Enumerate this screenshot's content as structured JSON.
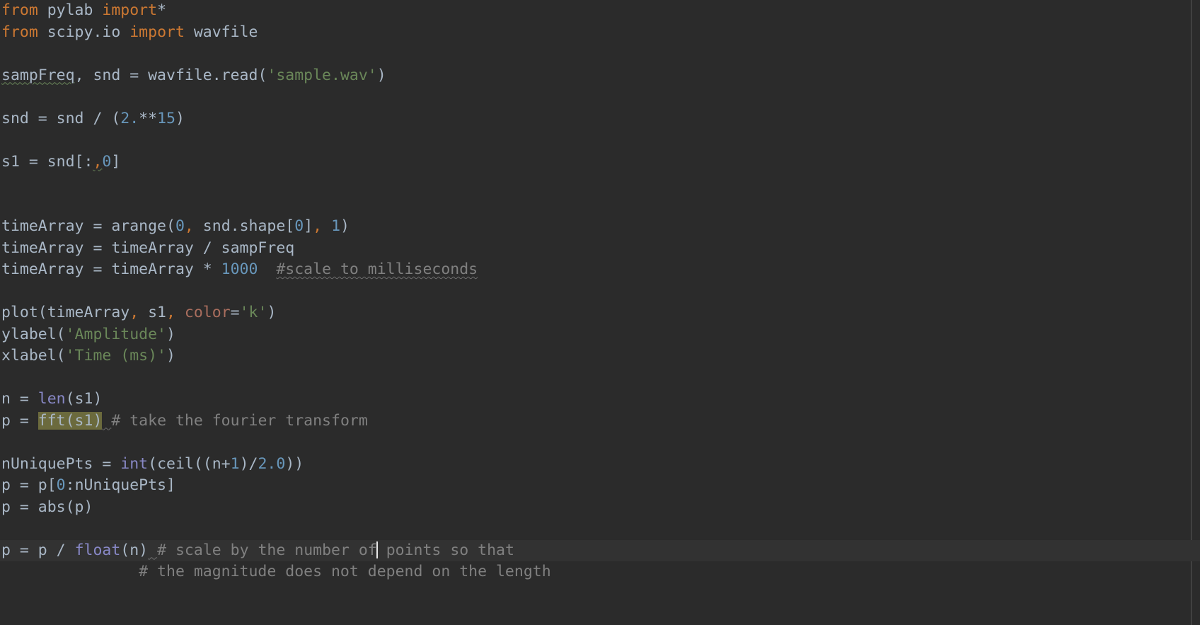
{
  "editor": {
    "language": "python",
    "theme": "darcula",
    "background_color": "#2b2b2b",
    "current_line_color": "#323232",
    "default_text_color": "#a9b7c6",
    "keyword_color": "#cc7832",
    "number_color": "#6897bb",
    "string_color": "#6a8759",
    "comment_color": "#808080",
    "builtin_color": "#8888c6",
    "keyword_arg_color": "#aa6e5e",
    "selection_color": "#6b6a3d",
    "caret_color": "#e8e8e8",
    "margin_guide_color": "#555555",
    "selected_text": "fft(s1)",
    "caret_line_index": 27
  },
  "lines": [
    {
      "index": 0,
      "tokens": [
        {
          "t": "from",
          "c": "kw"
        },
        {
          "t": " pylab ",
          "c": "plain"
        },
        {
          "t": "import",
          "c": "kw"
        },
        {
          "t": "*",
          "c": "plain"
        }
      ]
    },
    {
      "index": 1,
      "tokens": [
        {
          "t": "from",
          "c": "kw"
        },
        {
          "t": " scipy.io ",
          "c": "plain"
        },
        {
          "t": "import",
          "c": "kw"
        },
        {
          "t": " wavfile",
          "c": "plain"
        }
      ]
    },
    {
      "index": 2,
      "tokens": []
    },
    {
      "index": 3,
      "tokens": [
        {
          "t": "sampFreq",
          "c": "plain squig"
        },
        {
          "t": ", snd = wavfile.read(",
          "c": "plain"
        },
        {
          "t": "'sample.wav'",
          "c": "str"
        },
        {
          "t": ")",
          "c": "plain"
        }
      ]
    },
    {
      "index": 4,
      "tokens": []
    },
    {
      "index": 5,
      "tokens": [
        {
          "t": "snd = snd / (",
          "c": "plain"
        },
        {
          "t": "2.",
          "c": "num"
        },
        {
          "t": "**",
          "c": "plain"
        },
        {
          "t": "15",
          "c": "num"
        },
        {
          "t": ")",
          "c": "plain"
        }
      ]
    },
    {
      "index": 6,
      "tokens": []
    },
    {
      "index": 7,
      "tokens": [
        {
          "t": "s1 = snd[:",
          "c": "plain"
        },
        {
          "t": ",",
          "c": "comma squig"
        },
        {
          "t": "0",
          "c": "num"
        },
        {
          "t": "]",
          "c": "plain"
        }
      ]
    },
    {
      "index": 8,
      "tokens": []
    },
    {
      "index": 9,
      "tokens": []
    },
    {
      "index": 10,
      "tokens": [
        {
          "t": "timeArray = arange(",
          "c": "plain"
        },
        {
          "t": "0",
          "c": "num"
        },
        {
          "t": ",",
          "c": "comma"
        },
        {
          "t": " snd.shape[",
          "c": "plain"
        },
        {
          "t": "0",
          "c": "num"
        },
        {
          "t": "]",
          "c": "plain"
        },
        {
          "t": ",",
          "c": "comma"
        },
        {
          "t": " ",
          "c": "plain"
        },
        {
          "t": "1",
          "c": "num"
        },
        {
          "t": ")",
          "c": "plain"
        }
      ]
    },
    {
      "index": 11,
      "tokens": [
        {
          "t": "timeArray = timeArray / sampFreq",
          "c": "plain"
        }
      ]
    },
    {
      "index": 12,
      "tokens": [
        {
          "t": "timeArray = timeArray * ",
          "c": "plain"
        },
        {
          "t": "1000",
          "c": "num"
        },
        {
          "t": "  ",
          "c": "plain"
        },
        {
          "t": "#scale to milliseconds",
          "c": "cmt squig-gray"
        }
      ]
    },
    {
      "index": 13,
      "tokens": []
    },
    {
      "index": 14,
      "tokens": [
        {
          "t": "plot(timeArray",
          "c": "plain"
        },
        {
          "t": ",",
          "c": "comma"
        },
        {
          "t": " s1",
          "c": "plain"
        },
        {
          "t": ",",
          "c": "comma"
        },
        {
          "t": " ",
          "c": "plain"
        },
        {
          "t": "color",
          "c": "kwarg"
        },
        {
          "t": "=",
          "c": "plain"
        },
        {
          "t": "'k'",
          "c": "str"
        },
        {
          "t": ")",
          "c": "plain"
        }
      ]
    },
    {
      "index": 15,
      "tokens": [
        {
          "t": "ylabel(",
          "c": "plain"
        },
        {
          "t": "'Amplitude'",
          "c": "str"
        },
        {
          "t": ")",
          "c": "plain"
        }
      ]
    },
    {
      "index": 16,
      "tokens": [
        {
          "t": "xlabel(",
          "c": "plain"
        },
        {
          "t": "'Time (ms)'",
          "c": "str"
        },
        {
          "t": ")",
          "c": "plain"
        }
      ]
    },
    {
      "index": 17,
      "tokens": []
    },
    {
      "index": 18,
      "tokens": [
        {
          "t": "n = ",
          "c": "plain"
        },
        {
          "t": "len",
          "c": "builtin"
        },
        {
          "t": "(s1)",
          "c": "plain"
        }
      ]
    },
    {
      "index": 19,
      "tokens": [
        {
          "t": "p = ",
          "c": "plain"
        },
        {
          "t": "fft(s1)",
          "c": "sel"
        },
        {
          "t": " ",
          "c": "plain squig-gray"
        },
        {
          "t": "# take the fourier transform",
          "c": "cmt"
        }
      ]
    },
    {
      "index": 20,
      "tokens": []
    },
    {
      "index": 21,
      "tokens": [
        {
          "t": "nUniquePts = ",
          "c": "plain"
        },
        {
          "t": "int",
          "c": "builtin"
        },
        {
          "t": "(ceil((n+",
          "c": "plain"
        },
        {
          "t": "1",
          "c": "num"
        },
        {
          "t": ")/",
          "c": "plain"
        },
        {
          "t": "2.0",
          "c": "num"
        },
        {
          "t": "))",
          "c": "plain"
        }
      ]
    },
    {
      "index": 22,
      "tokens": [
        {
          "t": "p = p[",
          "c": "plain"
        },
        {
          "t": "0",
          "c": "num"
        },
        {
          "t": ":nUniquePts]",
          "c": "plain"
        }
      ]
    },
    {
      "index": 23,
      "tokens": [
        {
          "t": "p = abs(p)",
          "c": "plain"
        }
      ]
    },
    {
      "index": 24,
      "tokens": []
    },
    {
      "index": 25,
      "tokens": [
        {
          "t": "p = p / ",
          "c": "plain"
        },
        {
          "t": "float",
          "c": "builtin"
        },
        {
          "t": "(n)",
          "c": "plain"
        },
        {
          "t": " ",
          "c": "plain squig-gray"
        },
        {
          "t": "# scale by the number of",
          "c": "cmt"
        },
        {
          "t": "CARET",
          "c": "caret"
        },
        {
          "t": " points so that",
          "c": "cmt"
        }
      ]
    },
    {
      "index": 26,
      "tokens": [
        {
          "t": "               # the magnitude does not depend on the length",
          "c": "cmt"
        }
      ]
    }
  ]
}
